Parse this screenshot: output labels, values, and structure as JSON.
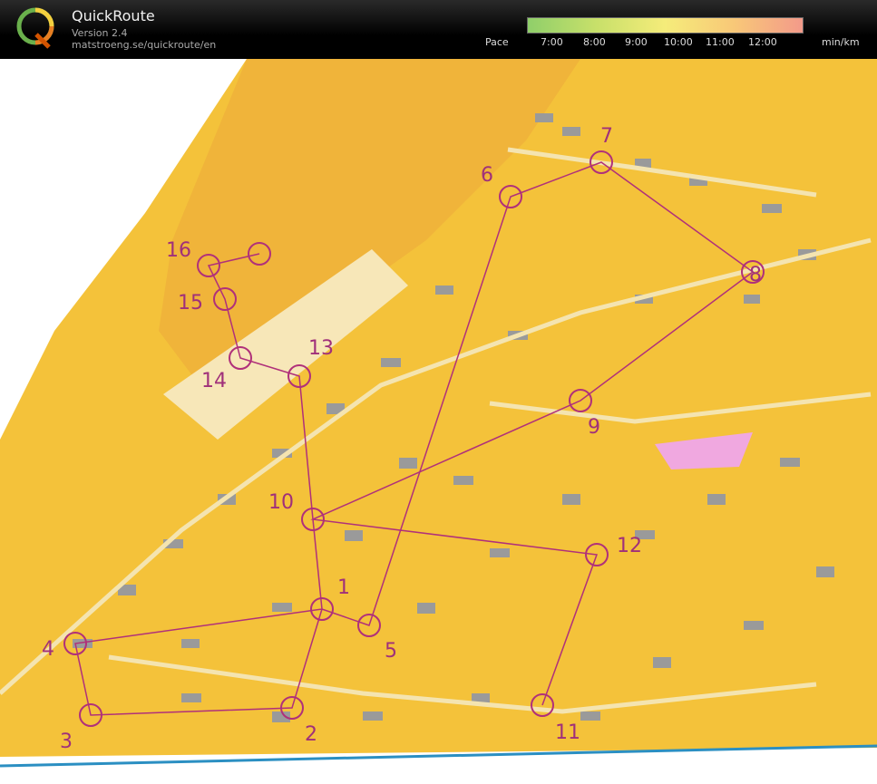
{
  "app": {
    "title": "QuickRoute",
    "version": "Version 2.4",
    "url": "matstroeng.se/quickroute/en"
  },
  "pace_scale": {
    "label": "Pace",
    "unit": "min/km",
    "ticks": [
      "7:00",
      "8:00",
      "9:00",
      "10:00",
      "11:00",
      "12:00"
    ],
    "colors": [
      "#8fcf6a",
      "#c8e06a",
      "#f5ec7a",
      "#f8c878",
      "#f39a8a"
    ]
  },
  "map": {
    "colors": {
      "open": "#f4c23a",
      "houses": "#9a9a9a",
      "course": "#b0307a",
      "roads": "#f4e4b0",
      "white": "#ffffff"
    },
    "controls": [
      "1",
      "2",
      "3",
      "4",
      "5",
      "6",
      "7",
      "8",
      "9",
      "10",
      "11",
      "12",
      "13",
      "14",
      "15",
      "16"
    ]
  }
}
